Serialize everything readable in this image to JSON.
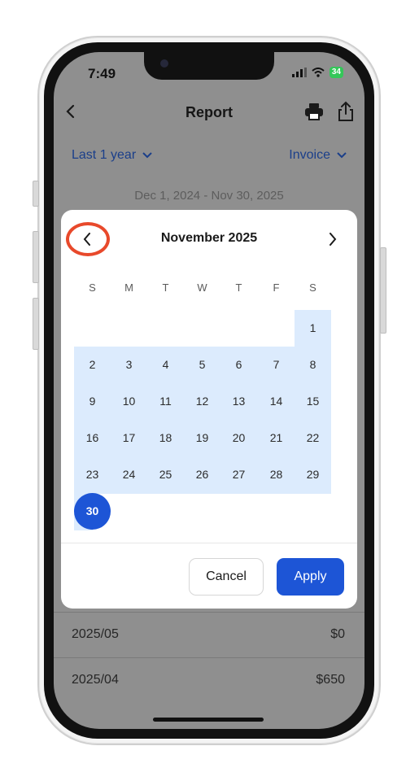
{
  "status_bar": {
    "time": "7:49",
    "battery": "34"
  },
  "nav": {
    "title": "Report"
  },
  "filters": {
    "period": "Last 1 year",
    "type": "Invoice"
  },
  "date_range": "Dec 1, 2024 - Nov 30, 2025",
  "report_rows": [
    {
      "label": "2025/05",
      "value": "$0"
    },
    {
      "label": "2025/04",
      "value": "$650"
    }
  ],
  "calendar": {
    "month_label": "November 2025",
    "weekdays": [
      "S",
      "M",
      "T",
      "W",
      "T",
      "F",
      "S"
    ],
    "days": [
      "1",
      "2",
      "3",
      "4",
      "5",
      "6",
      "7",
      "8",
      "9",
      "10",
      "11",
      "12",
      "13",
      "14",
      "15",
      "16",
      "17",
      "18",
      "19",
      "20",
      "21",
      "22",
      "23",
      "24",
      "25",
      "26",
      "27",
      "28",
      "29",
      "30"
    ],
    "selected_day": "30",
    "cancel_label": "Cancel",
    "apply_label": "Apply"
  },
  "colors": {
    "accent": "#1d55d6",
    "range_highlight": "#dcebfd",
    "annotation_ring": "#e8492b"
  }
}
